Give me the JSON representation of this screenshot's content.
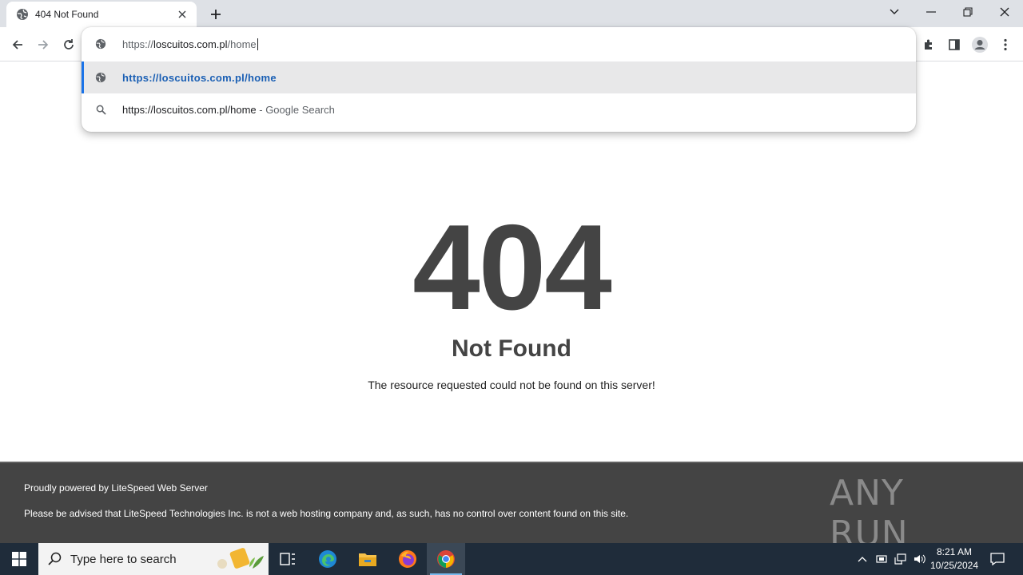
{
  "browser": {
    "tab": {
      "title": "404 Not Found"
    },
    "omnibox": {
      "url_prefix": "https://",
      "url_host": "loscuitos.com.pl",
      "url_path": "/home",
      "suggestions": [
        {
          "text": "https://loscuitos.com.pl/home",
          "sub": ""
        },
        {
          "text": "https://loscuitos.com.pl/home",
          "sub": " - Google Search"
        }
      ]
    }
  },
  "page": {
    "code": "404",
    "heading": "Not Found",
    "message": "The resource requested could not be found on this server!",
    "footer_powered": "Proudly powered by LiteSpeed Web Server",
    "footer_notice": "Please be advised that LiteSpeed Technologies Inc. is not a web hosting company and, as such, has no control over content found on this site.",
    "watermark": "ANY RUN"
  },
  "taskbar": {
    "search_placeholder": "Type here to search",
    "time": "8:21 AM",
    "date": "10/25/2024"
  },
  "colors": {
    "tabstrip": "#dee1e6",
    "accent": "#1a73e8",
    "page_text": "#444444",
    "footer_bg": "#444444",
    "taskbar_bg": "#1f2c3a"
  },
  "icons": {
    "favicon": "globe-icon",
    "suggestion_1": "globe-icon",
    "suggestion_2": "search-icon"
  }
}
